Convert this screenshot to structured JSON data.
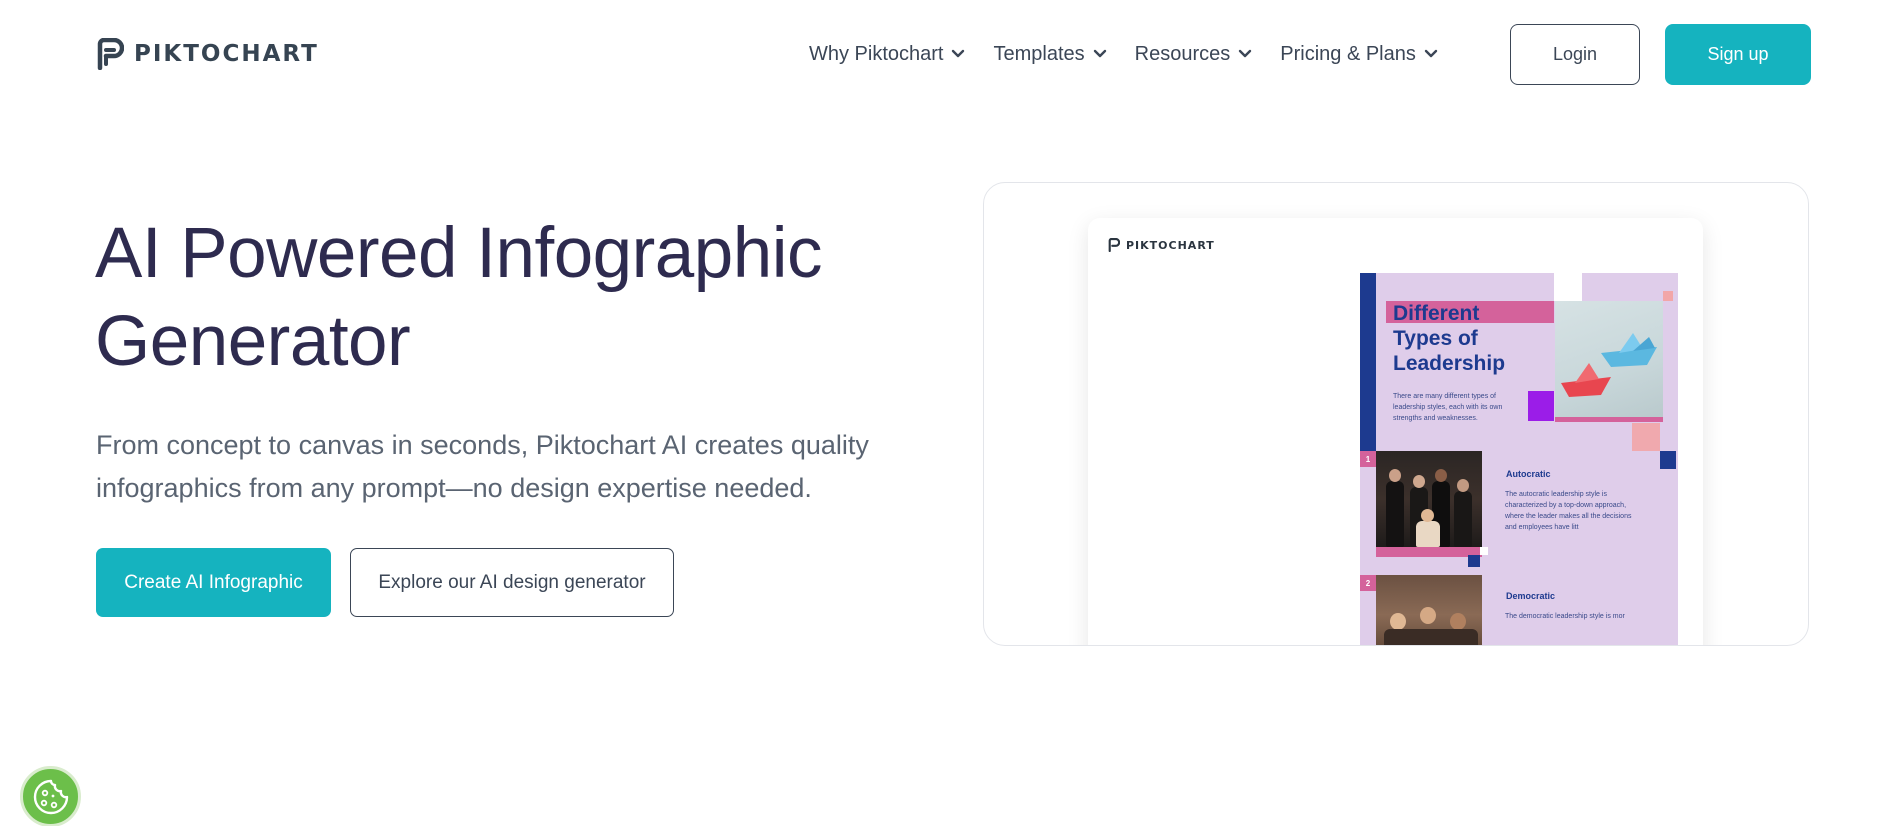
{
  "brand": {
    "name": "PIKTOCHART",
    "accent": "#15b3bf",
    "text_dark": "#2e2b4f"
  },
  "nav": {
    "items": [
      {
        "label": "Why Piktochart"
      },
      {
        "label": "Templates"
      },
      {
        "label": "Resources"
      },
      {
        "label": "Pricing & Plans"
      }
    ],
    "login_label": "Login",
    "signup_label": "Sign up"
  },
  "hero": {
    "title_line1": "AI Powered Infographic",
    "title_line2": "Generator",
    "subtitle_line1": "From concept to canvas in seconds, Piktochart AI creates quality",
    "subtitle_line2": "infographics from any prompt—no design expertise needed.",
    "primary_cta": "Create AI Infographic",
    "secondary_cta": "Explore our AI design generator"
  },
  "preview": {
    "logo_text": "PIKTOCHART",
    "infographic": {
      "title_line1": "Different",
      "title_line2": "Types of",
      "title_line3": "Leadership",
      "description": "There are many different types of leadership styles, each with its own strengths and weaknesses.",
      "sections": [
        {
          "number": "1",
          "title": "Autocratic",
          "text": "The autocratic leadership style is characterized by a top-down approach, where the leader makes all the decisions and employees have litt"
        },
        {
          "number": "2",
          "title": "Democratic",
          "text": "The democratic leadership style is mor"
        }
      ]
    }
  },
  "cookie": {
    "icon": "cookie-icon"
  }
}
